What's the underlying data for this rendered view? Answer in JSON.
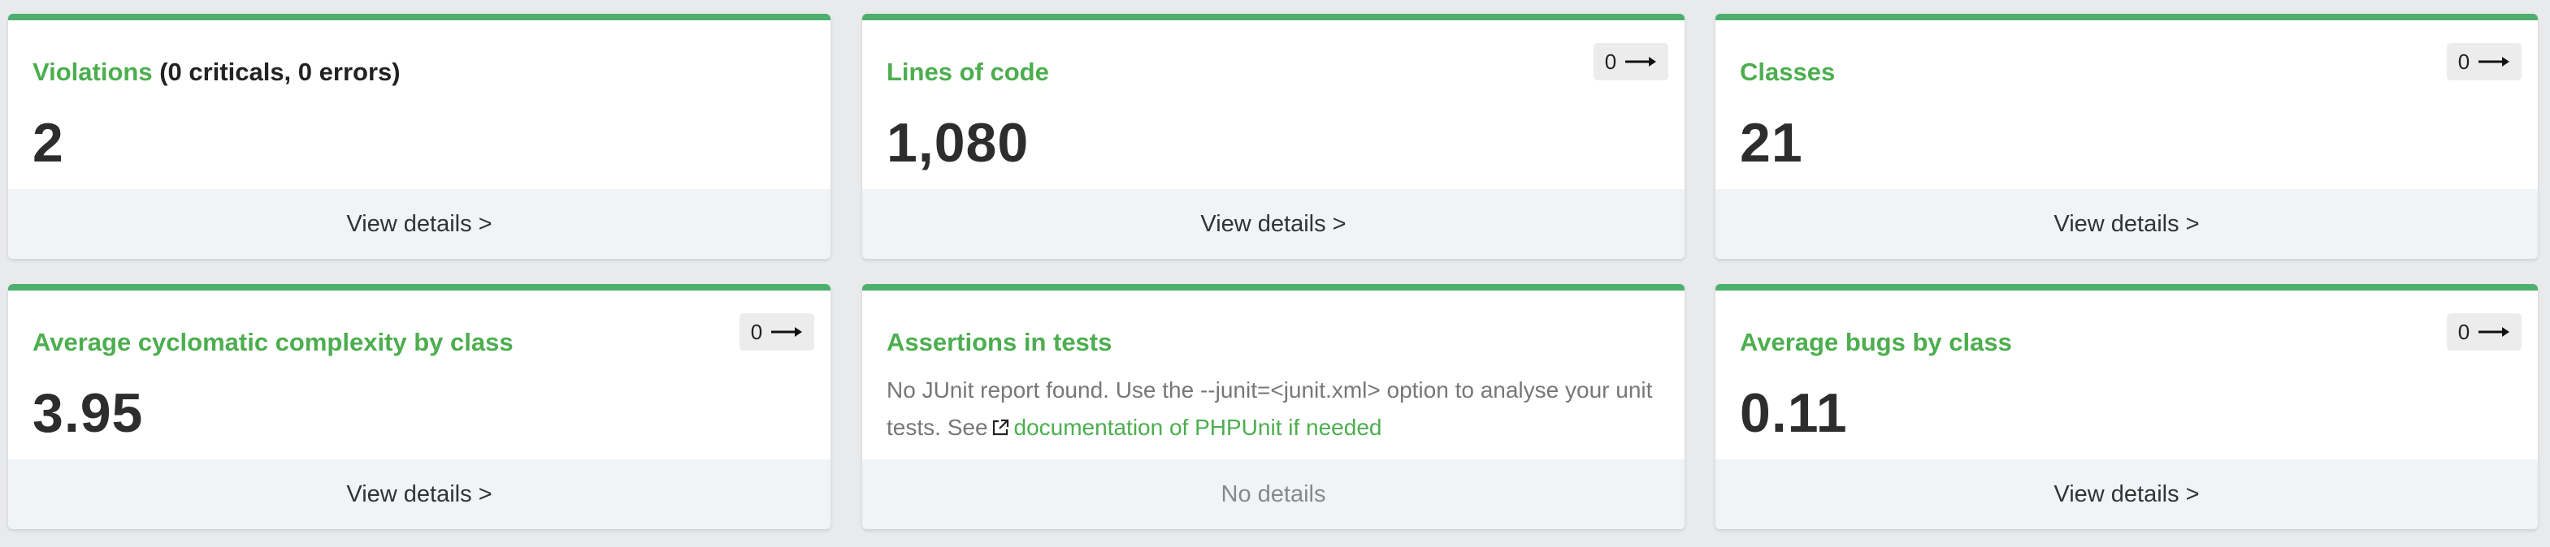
{
  "cards": [
    {
      "title": "Violations",
      "title_suffix": " (0 criticals, 0 errors)",
      "value": "2",
      "footer": "View details >"
    },
    {
      "title": "Lines of code",
      "badge": "0",
      "value": "1,080",
      "footer": "View details >"
    },
    {
      "title": "Classes",
      "badge": "0",
      "value": "21",
      "footer": "View details >"
    },
    {
      "title": "Average cyclomatic complexity by class",
      "badge": "0",
      "value": "3.95",
      "footer": "View details >"
    },
    {
      "title": "Assertions in tests",
      "text": "No JUnit report found. Use the --junit=<junit.xml> option to analyse your unit tests. See",
      "link": "documentation of PHPUnit if needed",
      "footer": "No details"
    },
    {
      "title": "Average bugs by class",
      "badge": "0",
      "value": "0.11",
      "footer": "View details >"
    }
  ],
  "icons": {
    "badge_arrow": "arrow-right-icon",
    "external_link": "external-link-icon"
  },
  "colors": {
    "accent": "#4cae4f",
    "card_top_border": "#4caf6e",
    "footer_bg": "#f1f4f7",
    "page_bg": "#e9eaec"
  }
}
